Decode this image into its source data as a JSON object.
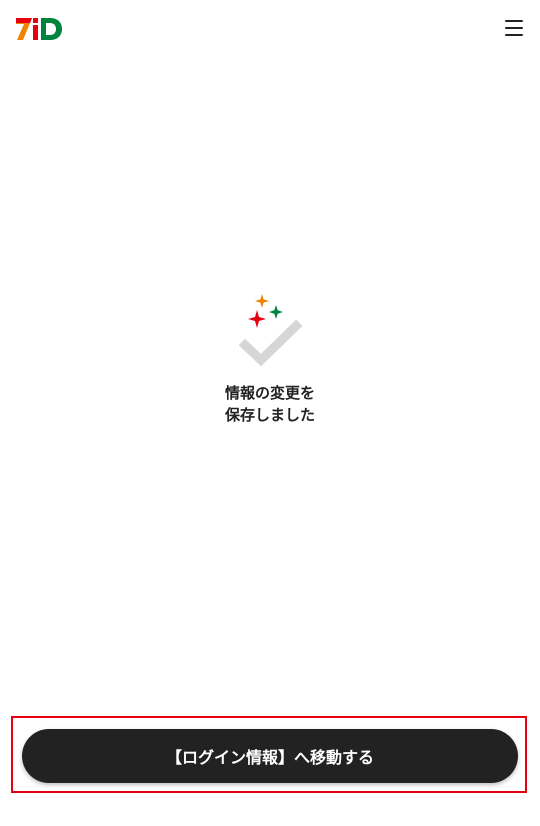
{
  "header": {
    "logo_text": "7iD",
    "menu_icon": "hamburger-menu-icon"
  },
  "success": {
    "icon": "sparkle-check-icon",
    "line1": "情報の変更を",
    "line2": "保存しました"
  },
  "action": {
    "button_label": "【ログイン情報】へ移動する"
  },
  "colors": {
    "brand_red": "#e60012",
    "brand_green": "#00843d",
    "brand_orange": "#f08300",
    "button_bg": "#222222",
    "check_gray": "#d6d6d6",
    "highlight_border": "#e60012"
  }
}
